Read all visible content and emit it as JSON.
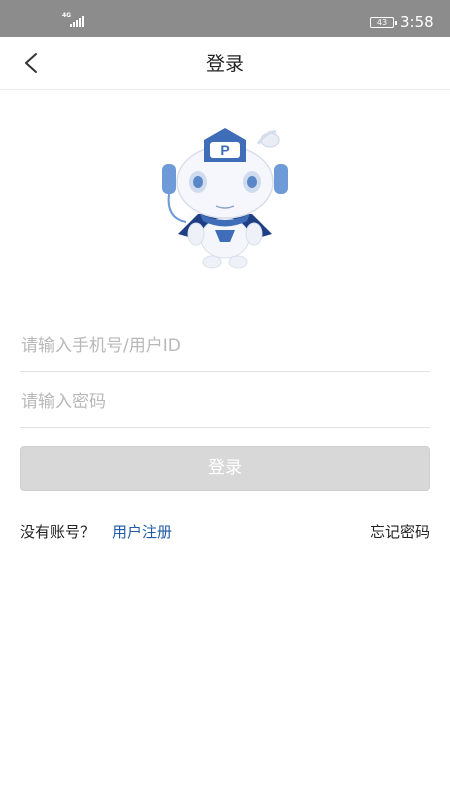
{
  "status_bar": {
    "network_label": "4G",
    "battery": "43",
    "time": "3:58"
  },
  "navbar": {
    "back_icon": "chevron-left-icon",
    "title": "登录"
  },
  "mascot": {
    "badge_letter": "P"
  },
  "form": {
    "phone_placeholder": "请输入手机号/用户ID",
    "password_placeholder": "请输入密码",
    "login_button": "登录"
  },
  "footer_links": {
    "no_account": "没有账号？",
    "register": "用户注册",
    "forgot_password": "忘记密码"
  },
  "colors": {
    "status_bar": "#8c8c8c",
    "link": "#1e5aa8",
    "button_disabled": "#d8d8d8",
    "mascot_blue": "#3f6db8"
  }
}
